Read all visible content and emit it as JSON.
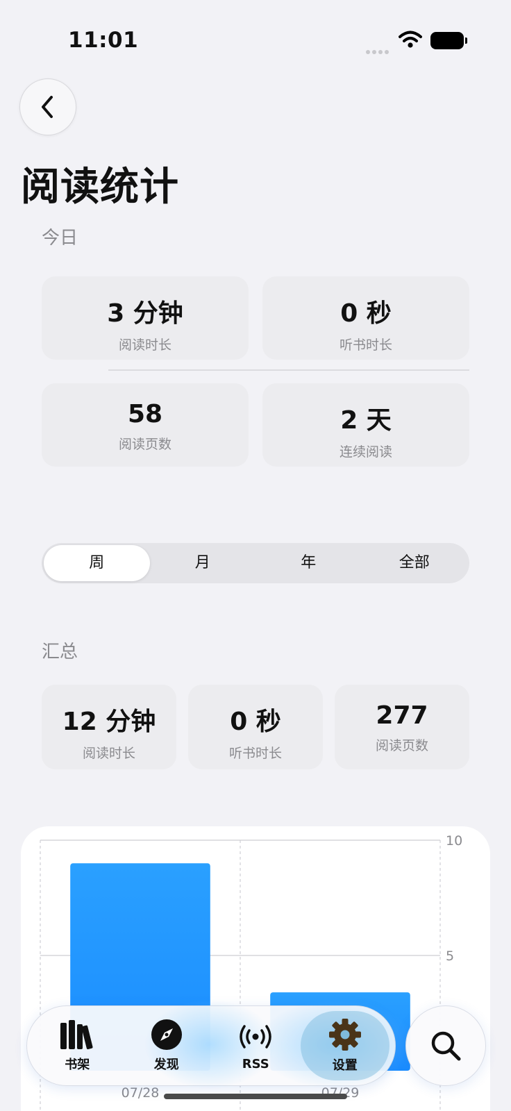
{
  "status_bar": {
    "time": "11:01"
  },
  "page": {
    "title": "阅读统计"
  },
  "today": {
    "label": "今日",
    "stats": [
      {
        "value": "3 分钟",
        "label": "阅读时长"
      },
      {
        "value": "0 秒",
        "label": "听书时长"
      },
      {
        "value": "58",
        "label": "阅读页数"
      },
      {
        "value": "2 天",
        "label": "连续阅读"
      }
    ]
  },
  "period_tabs": {
    "items": [
      "周",
      "月",
      "年",
      "全部"
    ],
    "selected": "周"
  },
  "summary": {
    "label": "汇总",
    "stats": [
      {
        "value": "12 分钟",
        "label": "阅读时长"
      },
      {
        "value": "0 秒",
        "label": "听书时长"
      },
      {
        "value": "277",
        "label": "阅读页数"
      }
    ]
  },
  "chart_data": {
    "type": "bar",
    "categories": [
      "07/28",
      "07/29"
    ],
    "values": [
      9,
      3.4
    ],
    "y_ticks": [
      "10",
      "5"
    ],
    "ylim": [
      0,
      10
    ],
    "bar_color": "#1a8cff",
    "grid": true
  },
  "tab_bar": {
    "items": [
      {
        "label": "书架",
        "icon": "books-icon"
      },
      {
        "label": "发现",
        "icon": "compass-icon"
      },
      {
        "label": "RSS",
        "icon": "rss-icon"
      },
      {
        "label": "设置",
        "icon": "gear-icon"
      }
    ],
    "selected": "设置",
    "search_icon": "search-icon"
  },
  "colors": {
    "accent": "#1a8cff",
    "background": "#f2f2f6",
    "card": "#ececef"
  }
}
